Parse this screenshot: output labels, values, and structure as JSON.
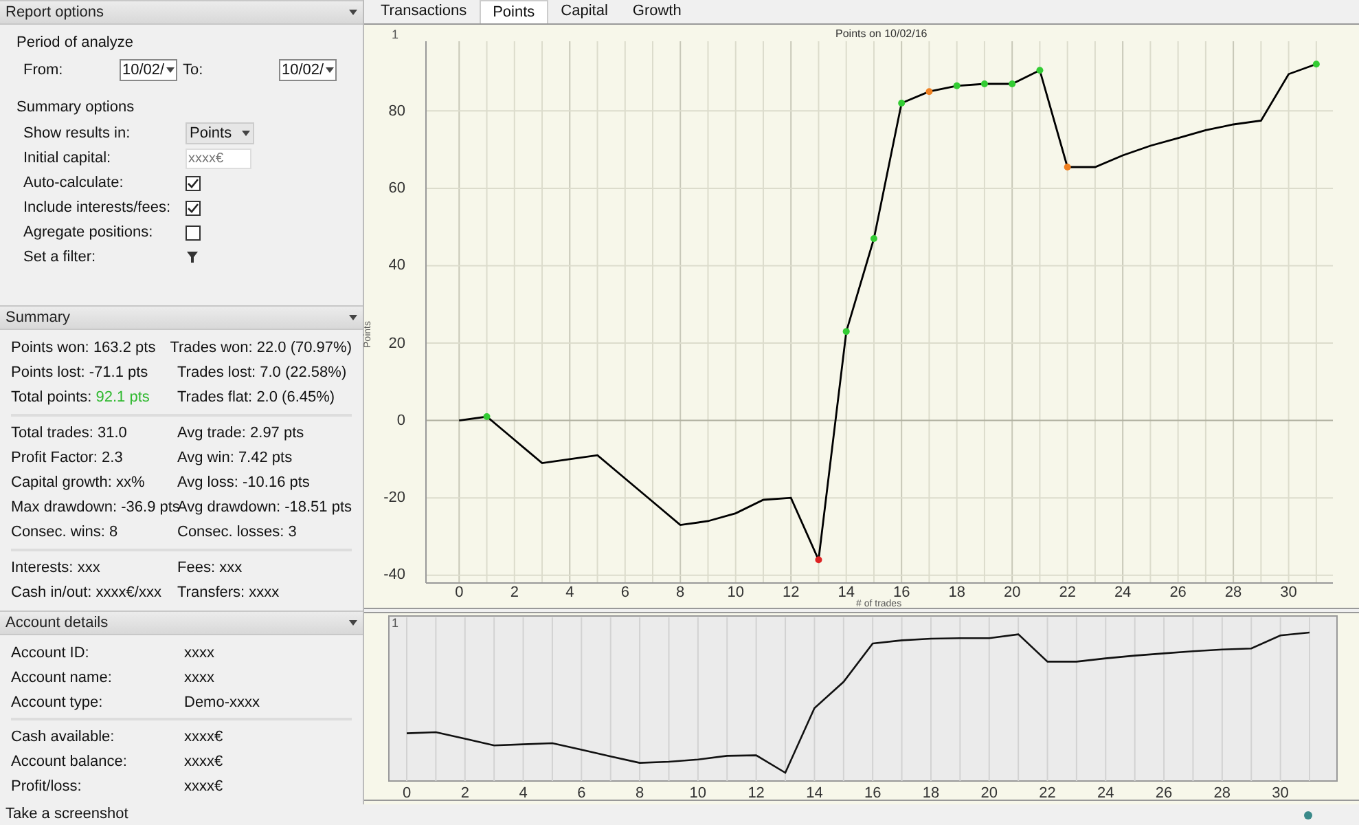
{
  "report_options": {
    "title": "Report options",
    "period_heading": "Period of analyze",
    "from_label": "From:",
    "from_value": "10/02/",
    "to_label": "To:",
    "to_value": "10/02/",
    "summary_heading": "Summary options",
    "rows": [
      {
        "kind": "select",
        "label": "Show results in:",
        "value": "Points"
      },
      {
        "kind": "input",
        "label": "Initial capital:",
        "placeholder": "xxxx€"
      },
      {
        "kind": "checkbox",
        "label": "Auto-calculate:",
        "checked": true
      },
      {
        "kind": "checkbox",
        "label": "Include interests/fees:",
        "checked": true
      },
      {
        "kind": "checkbox",
        "label": "Agregate positions:",
        "checked": false
      },
      {
        "kind": "filter",
        "label": "Set a filter:"
      }
    ]
  },
  "summary": {
    "title": "Summary",
    "groups": [
      [
        [
          {
            "label": "Points won:",
            "value": "163.2 pts"
          },
          {
            "label": "Trades won:",
            "value": "22.0 (70.97%)"
          }
        ],
        [
          {
            "label": "Points lost:",
            "value": "-71.1 pts"
          },
          {
            "label": "Trades lost:",
            "value": "7.0 (22.58%)"
          }
        ],
        [
          {
            "label": "Total points:",
            "value": "92.1 pts",
            "color": "#2eb82e"
          },
          {
            "label": "Trades flat:",
            "value": "2.0 (6.45%)"
          }
        ]
      ],
      [
        [
          {
            "label": "Total trades:",
            "value": "31.0"
          },
          {
            "label": "Avg trade:",
            "value": "2.97 pts"
          }
        ],
        [
          {
            "label": "Profit Factor:",
            "value": "2.3"
          },
          {
            "label": "Avg win:",
            "value": "7.42 pts"
          }
        ],
        [
          {
            "label": "Capital growth:",
            "value": "xx%"
          },
          {
            "label": "Avg loss:",
            "value": "-10.16 pts"
          }
        ],
        [
          {
            "label": "Max drawdown:",
            "value": "-36.9 pts"
          },
          {
            "label": "Avg drawdown:",
            "value": "-18.51 pts"
          }
        ],
        [
          {
            "label": "Consec. wins:",
            "value": "8"
          },
          {
            "label": "Consec. losses:",
            "value": "3"
          }
        ]
      ],
      [
        [
          {
            "label": "Interests:",
            "value": "xxx"
          },
          {
            "label": "Fees:",
            "value": "xxx"
          }
        ],
        [
          {
            "label": "Cash in/out:",
            "value": "xxxx€/xxx"
          },
          {
            "label": "Transfers:",
            "value": "xxxx"
          }
        ]
      ]
    ]
  },
  "account_details": {
    "title": "Account details",
    "groups": [
      [
        {
          "label": "Account ID:",
          "value": "xxxx"
        },
        {
          "label": "Account name:",
          "value": "xxxx"
        },
        {
          "label": "Account type:",
          "value": "Demo-xxxx"
        }
      ],
      [
        {
          "label": "Cash available:",
          "value": "xxxx€"
        },
        {
          "label": "Account balance:",
          "value": "xxxx€"
        },
        {
          "label": "Profit/loss:",
          "value": "xxxx€"
        }
      ]
    ]
  },
  "status_bar": {
    "text": "Take a screenshot"
  },
  "tabs": [
    {
      "label": "Transactions",
      "selected": false
    },
    {
      "label": "Points",
      "selected": true
    },
    {
      "label": "Capital",
      "selected": false
    },
    {
      "label": "Growth",
      "selected": false
    }
  ],
  "points_chart": {
    "corner_label": "1",
    "chart_data": {
      "type": "line",
      "title": "Points on 10/02/16",
      "xlabel": "# of trades",
      "ylabel": "Points",
      "x": [
        0,
        1,
        2,
        3,
        4,
        5,
        6,
        7,
        8,
        9,
        10,
        11,
        12,
        13,
        14,
        15,
        16,
        17,
        18,
        19,
        20,
        21,
        22,
        23,
        24,
        25,
        26,
        27,
        28,
        29,
        30,
        31
      ],
      "series": [
        {
          "color": "#000000",
          "values": [
            0,
            1,
            -5,
            -11,
            -10,
            -9,
            -15,
            -21,
            -27,
            -26,
            -24,
            -20.5,
            -20,
            -36,
            23,
            47,
            82,
            85,
            86.5,
            87,
            87,
            90.5,
            65.5,
            65.5,
            68.5,
            71,
            73,
            75,
            76.5,
            77.5,
            89.5,
            92.1
          ]
        }
      ],
      "xlim": [
        -1.2,
        31.6
      ],
      "ylim": [
        -42,
        98
      ],
      "xticks": [
        0,
        2,
        4,
        6,
        8,
        10,
        12,
        14,
        16,
        18,
        20,
        22,
        24,
        26,
        28,
        30
      ],
      "yticks": [
        -40,
        -20,
        0,
        20,
        40,
        60,
        80
      ],
      "grid": true
    },
    "markers": [
      {
        "kind": "plain"
      },
      {
        "kind": "win"
      },
      {
        "kind": "plain"
      },
      {
        "kind": "plain"
      },
      {
        "kind": "plain"
      },
      {
        "kind": "plain"
      },
      {
        "kind": "plain"
      },
      {
        "kind": "plain"
      },
      {
        "kind": "plain"
      },
      {
        "kind": "plain"
      },
      {
        "kind": "plain"
      },
      {
        "kind": "plain"
      },
      {
        "kind": "plain"
      },
      {
        "kind": "loss"
      },
      {
        "kind": "win"
      },
      {
        "kind": "win"
      },
      {
        "kind": "win"
      },
      {
        "kind": "flat"
      },
      {
        "kind": "win"
      },
      {
        "kind": "win"
      },
      {
        "kind": "win"
      },
      {
        "kind": "win"
      },
      {
        "kind": "flat"
      },
      {
        "kind": "plain"
      },
      {
        "kind": "plain"
      },
      {
        "kind": "plain"
      },
      {
        "kind": "plain"
      },
      {
        "kind": "plain"
      },
      {
        "kind": "plain"
      },
      {
        "kind": "plain"
      },
      {
        "kind": "plain"
      },
      {
        "kind": "win"
      }
    ]
  },
  "overview": {
    "corner_label": "1",
    "xticks": [
      "0",
      "2",
      "4",
      "6",
      "8",
      "10",
      "12",
      "14",
      "16",
      "18",
      "20",
      "22",
      "24",
      "26",
      "28",
      "30"
    ]
  }
}
